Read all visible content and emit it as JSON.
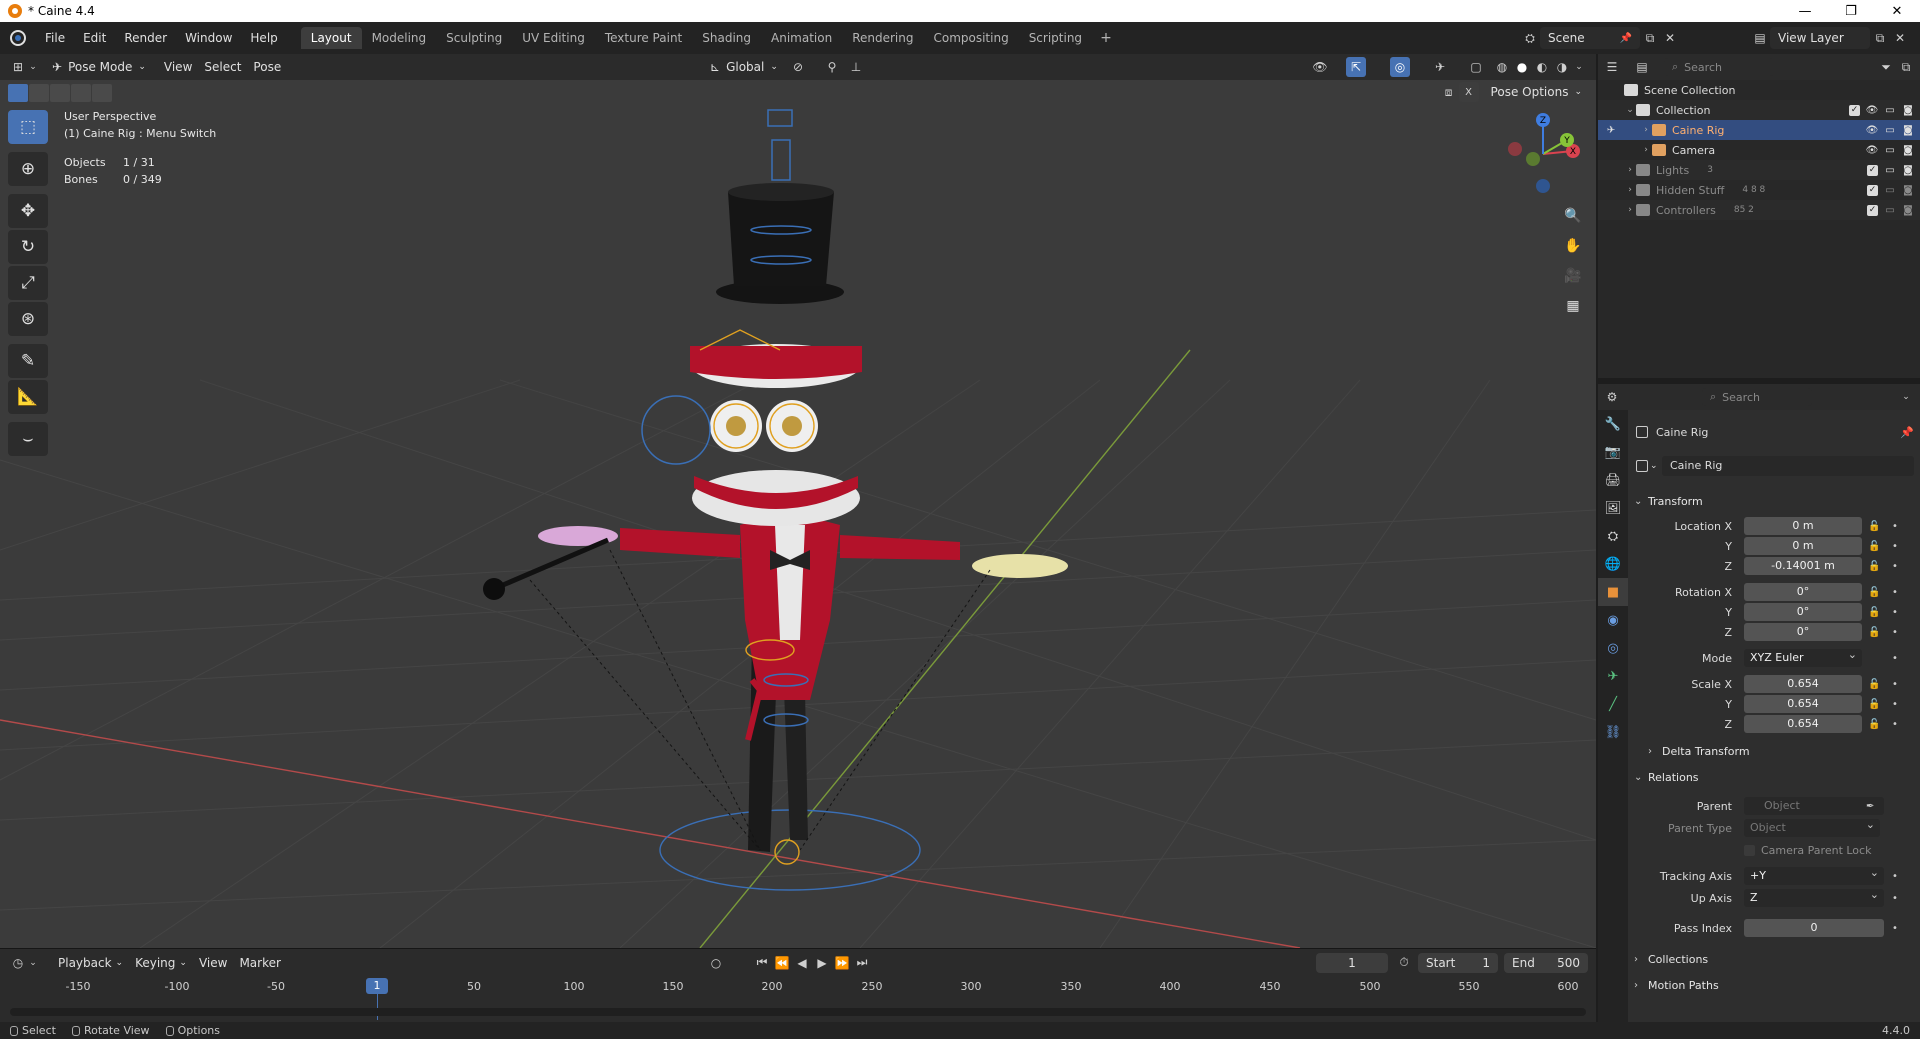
{
  "window": {
    "title": "* Caine 4.4",
    "controls": {
      "minimize": "—",
      "maximize": "❐",
      "close": "✕"
    }
  },
  "topbar": {
    "menus": [
      "File",
      "Edit",
      "Render",
      "Window",
      "Help"
    ],
    "workspaces": [
      "Layout",
      "Modeling",
      "Sculpting",
      "UV Editing",
      "Texture Paint",
      "Shading",
      "Animation",
      "Rendering",
      "Compositing",
      "Scripting"
    ],
    "active_workspace": "Layout",
    "add_workspace": "+",
    "scene": "Scene",
    "view_layer": "View Layer"
  },
  "viewport_header": {
    "mode": "Pose Mode",
    "menus": [
      "View",
      "Select",
      "Pose"
    ],
    "transform_orientation": "Global",
    "pose_options": "Pose Options"
  },
  "viewport": {
    "perspective": "User Perspective",
    "active": "(1) Caine Rig : Menu Switch",
    "stats": [
      {
        "label": "Objects",
        "value": "1 / 31"
      },
      {
        "label": "Bones",
        "value": "0 / 349"
      }
    ],
    "gizmo_axes": [
      "X",
      "Y",
      "Z"
    ]
  },
  "timeline": {
    "menus": [
      "Playback",
      "Keying",
      "View",
      "Marker"
    ],
    "current_frame": "1",
    "start_label": "Start",
    "start": "1",
    "end_label": "End",
    "end": "500",
    "ticks": [
      "-150",
      "-100",
      "-50",
      "50",
      "100",
      "150",
      "200",
      "250",
      "300",
      "350",
      "400",
      "450",
      "500",
      "550",
      "600"
    ],
    "playhead": "1"
  },
  "statusbar": {
    "items": [
      "Select",
      "Rotate View",
      "Options"
    ],
    "version": "4.4.0"
  },
  "outliner": {
    "search_placeholder": "Search",
    "rows": [
      {
        "label": "Scene Collection",
        "indent": 0
      },
      {
        "label": "Collection",
        "indent": 1
      },
      {
        "label": "Caine Rig",
        "indent": 2
      },
      {
        "label": "Camera",
        "indent": 2
      },
      {
        "label": "Lights",
        "indent": 1,
        "badge": "3"
      },
      {
        "label": "Hidden Stuff",
        "indent": 1,
        "badge": "4 8 8"
      },
      {
        "label": "Controllers",
        "indent": 1,
        "badge": "85 2"
      }
    ]
  },
  "properties": {
    "search_placeholder": "Search",
    "object_name": "Caine Rig",
    "object_field": "Caine Rig",
    "transform_title": "Transform",
    "location": {
      "label": "Location X",
      "x": "0 m",
      "y": "0 m",
      "z": "-0.14001 m"
    },
    "rotation": {
      "label": "Rotation X",
      "x": "0°",
      "y": "0°",
      "z": "0°"
    },
    "mode_label": "Mode",
    "mode": "XYZ Euler",
    "scale": {
      "label": "Scale X",
      "x": "0.654",
      "y": "0.654",
      "z": "0.654"
    },
    "axis_y": "Y",
    "axis_z": "Z",
    "delta_transform": "Delta Transform",
    "relations_title": "Relations",
    "parent_label": "Parent",
    "parent_placeholder": "Object",
    "parent_type_label": "Parent Type",
    "parent_type": "Object",
    "camera_parent_lock": "Camera Parent Lock",
    "tracking_axis_label": "Tracking Axis",
    "tracking_axis": "+Y",
    "up_axis_label": "Up Axis",
    "up_axis": "Z",
    "pass_index_label": "Pass Index",
    "pass_index": "0",
    "collections": "Collections",
    "motion_paths": "Motion Paths"
  },
  "colors": {
    "accent": "#4772b3",
    "x_axis": "#d9434f",
    "y_axis": "#87c438",
    "z_axis": "#3f7de0",
    "character_red": "#b3122a"
  }
}
